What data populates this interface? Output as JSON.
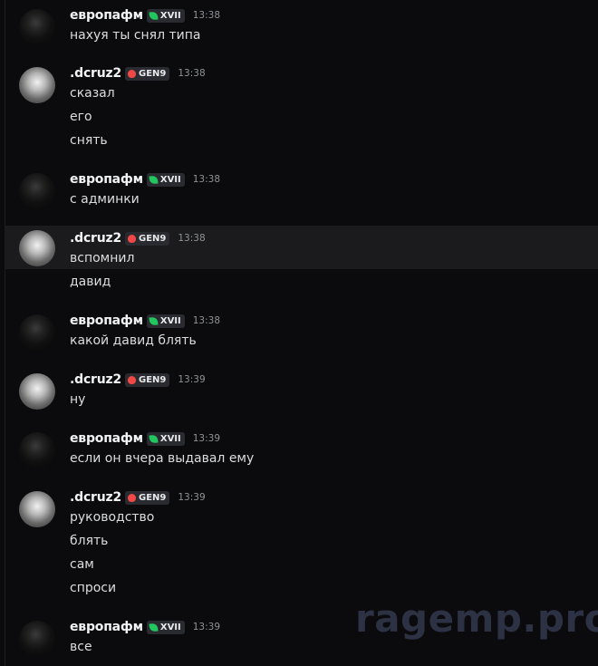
{
  "messages": [
    {
      "user": "европафм",
      "tag": "XVII",
      "tag_icon": "leaf-icon",
      "time": "13:38",
      "lines": [
        "нахуя ты снял типа"
      ]
    },
    {
      "user": ".dcruz2",
      "tag": "GEN9",
      "tag_icon": "pig-icon",
      "time": "13:38",
      "lines": [
        "сказал",
        "его",
        "снять"
      ]
    },
    {
      "user": "европафм",
      "tag": "XVII",
      "tag_icon": "leaf-icon",
      "time": "13:38",
      "lines": [
        "с админки"
      ]
    },
    {
      "user": ".dcruz2",
      "tag": "GEN9",
      "tag_icon": "pig-icon",
      "time": "13:38",
      "lines": [
        "вспомнил",
        "давид"
      ]
    },
    {
      "user": "европафм",
      "tag": "XVII",
      "tag_icon": "leaf-icon",
      "time": "13:38",
      "lines": [
        "какой давид блять"
      ]
    },
    {
      "user": ".dcruz2",
      "tag": "GEN9",
      "tag_icon": "pig-icon",
      "time": "13:39",
      "lines": [
        "ну"
      ]
    },
    {
      "user": "европафм",
      "tag": "XVII",
      "tag_icon": "leaf-icon",
      "time": "13:39",
      "lines": [
        "если он вчера выдавал ему"
      ]
    },
    {
      "user": ".dcruz2",
      "tag": "GEN9",
      "tag_icon": "pig-icon",
      "time": "13:39",
      "lines": [
        "руководство",
        "блять",
        "сам",
        "спроси"
      ]
    },
    {
      "user": "европафм",
      "tag": "XVII",
      "tag_icon": "leaf-icon",
      "time": "13:39",
      "lines": [
        "все"
      ]
    }
  ],
  "colors": {
    "background": "#0b0b0d",
    "highlight": "#1b1b1e",
    "username": "#f2f3f5",
    "text": "#dcdde0",
    "timestamp": "#8e9297",
    "leaf_badge": "#23c55e",
    "pig_badge": "#f04747"
  },
  "watermark": "ragemp.pro"
}
